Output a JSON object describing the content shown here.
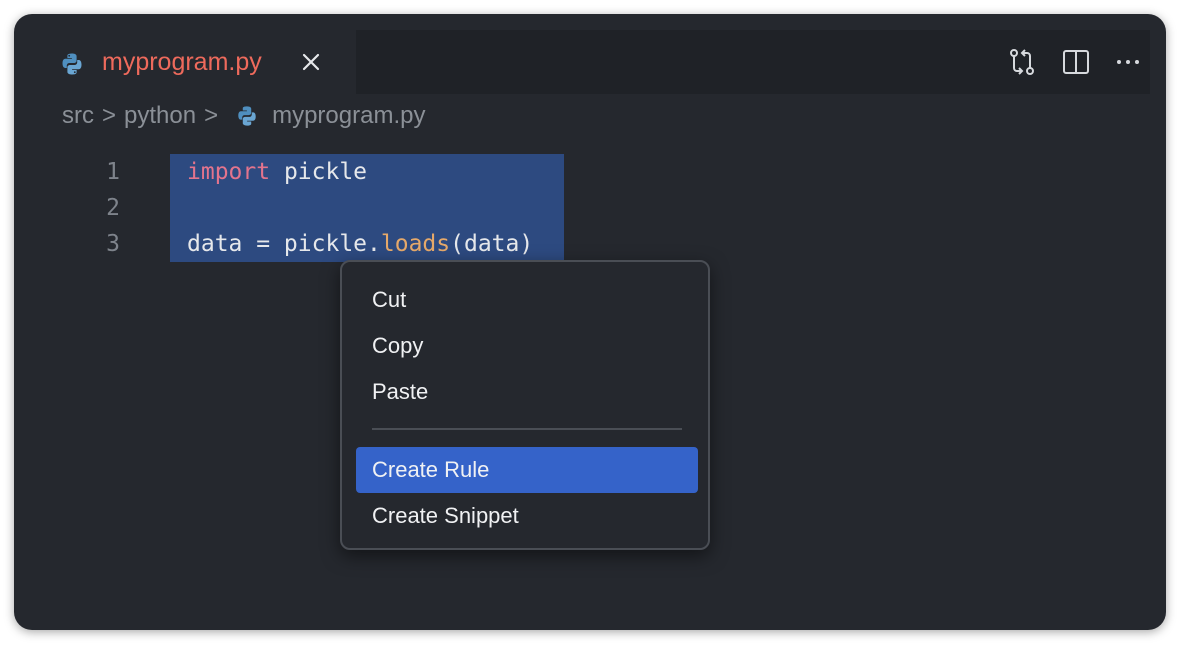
{
  "tab": {
    "title": "myprogram.py",
    "file_icon": "python-icon",
    "close_icon": "close-icon"
  },
  "toolbar": {
    "icons": [
      "compare-changes-icon",
      "split-editor-icon",
      "more-actions-icon"
    ]
  },
  "breadcrumb": {
    "items": [
      "src",
      "python",
      "myprogram.py"
    ],
    "separator": ">"
  },
  "editor": {
    "lines": [
      {
        "number": "1",
        "tokens": [
          {
            "text": "import",
            "kind": "keyword"
          },
          {
            "text": " pickle",
            "kind": "plain"
          }
        ]
      },
      {
        "number": "2",
        "tokens": []
      },
      {
        "number": "3",
        "tokens": [
          {
            "text": "data = pickle.",
            "kind": "plain"
          },
          {
            "text": "loads",
            "kind": "function"
          },
          {
            "text": "(data)",
            "kind": "plain"
          }
        ]
      }
    ],
    "selected_lines": [
      "1",
      "2",
      "3"
    ]
  },
  "context_menu": {
    "items": [
      "Cut",
      "Copy",
      "Paste",
      "Create Rule",
      "Create Snippet"
    ],
    "highlighted": "Create Rule"
  },
  "colors": {
    "background": "#25282e",
    "tab_title": "#ee6a5c",
    "keyword": "#e3748d",
    "function": "#e6a96a",
    "selection": "#2d4a80",
    "menu_highlight": "#3563c9"
  }
}
